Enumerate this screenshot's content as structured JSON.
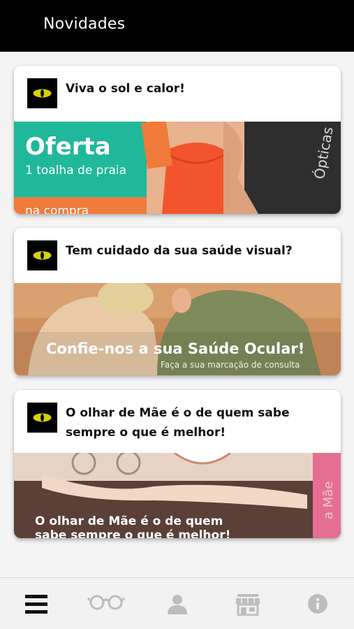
{
  "header": {
    "title": "Novidades"
  },
  "posts": [
    {
      "title": "Viva o sol e calor!",
      "banner": {
        "headline": "Oferta",
        "subline": "1 toalha de praia",
        "footer": "na compra",
        "side_text": "Ópticas"
      }
    },
    {
      "title": "Tem cuidado da sua saúde visual?",
      "banner": {
        "headline": "Confie-nos a sua Saúde Ocular!",
        "subline": "Faça a sua marcação de consulta"
      }
    },
    {
      "title": "O olhar de Mãe é o de quem sabe sempre o que é melhor!",
      "banner": {
        "line1": "O olhar de Mãe é o de quem",
        "line2": "sabe sempre o que é melhor!",
        "side_text": "a Mãe"
      }
    }
  ],
  "bottom_nav": [
    {
      "icon": "menu-icon",
      "active": true
    },
    {
      "icon": "glasses-icon",
      "active": false
    },
    {
      "icon": "profile-icon",
      "active": false
    },
    {
      "icon": "store-icon",
      "active": false
    },
    {
      "icon": "info-icon",
      "active": false
    }
  ],
  "colors": {
    "header_bg": "#000000",
    "offer_teal": "#1fb89a",
    "offer_orange": "#f07b3a",
    "nav_active": "#111111",
    "nav_inactive": "#bdbdbd"
  }
}
